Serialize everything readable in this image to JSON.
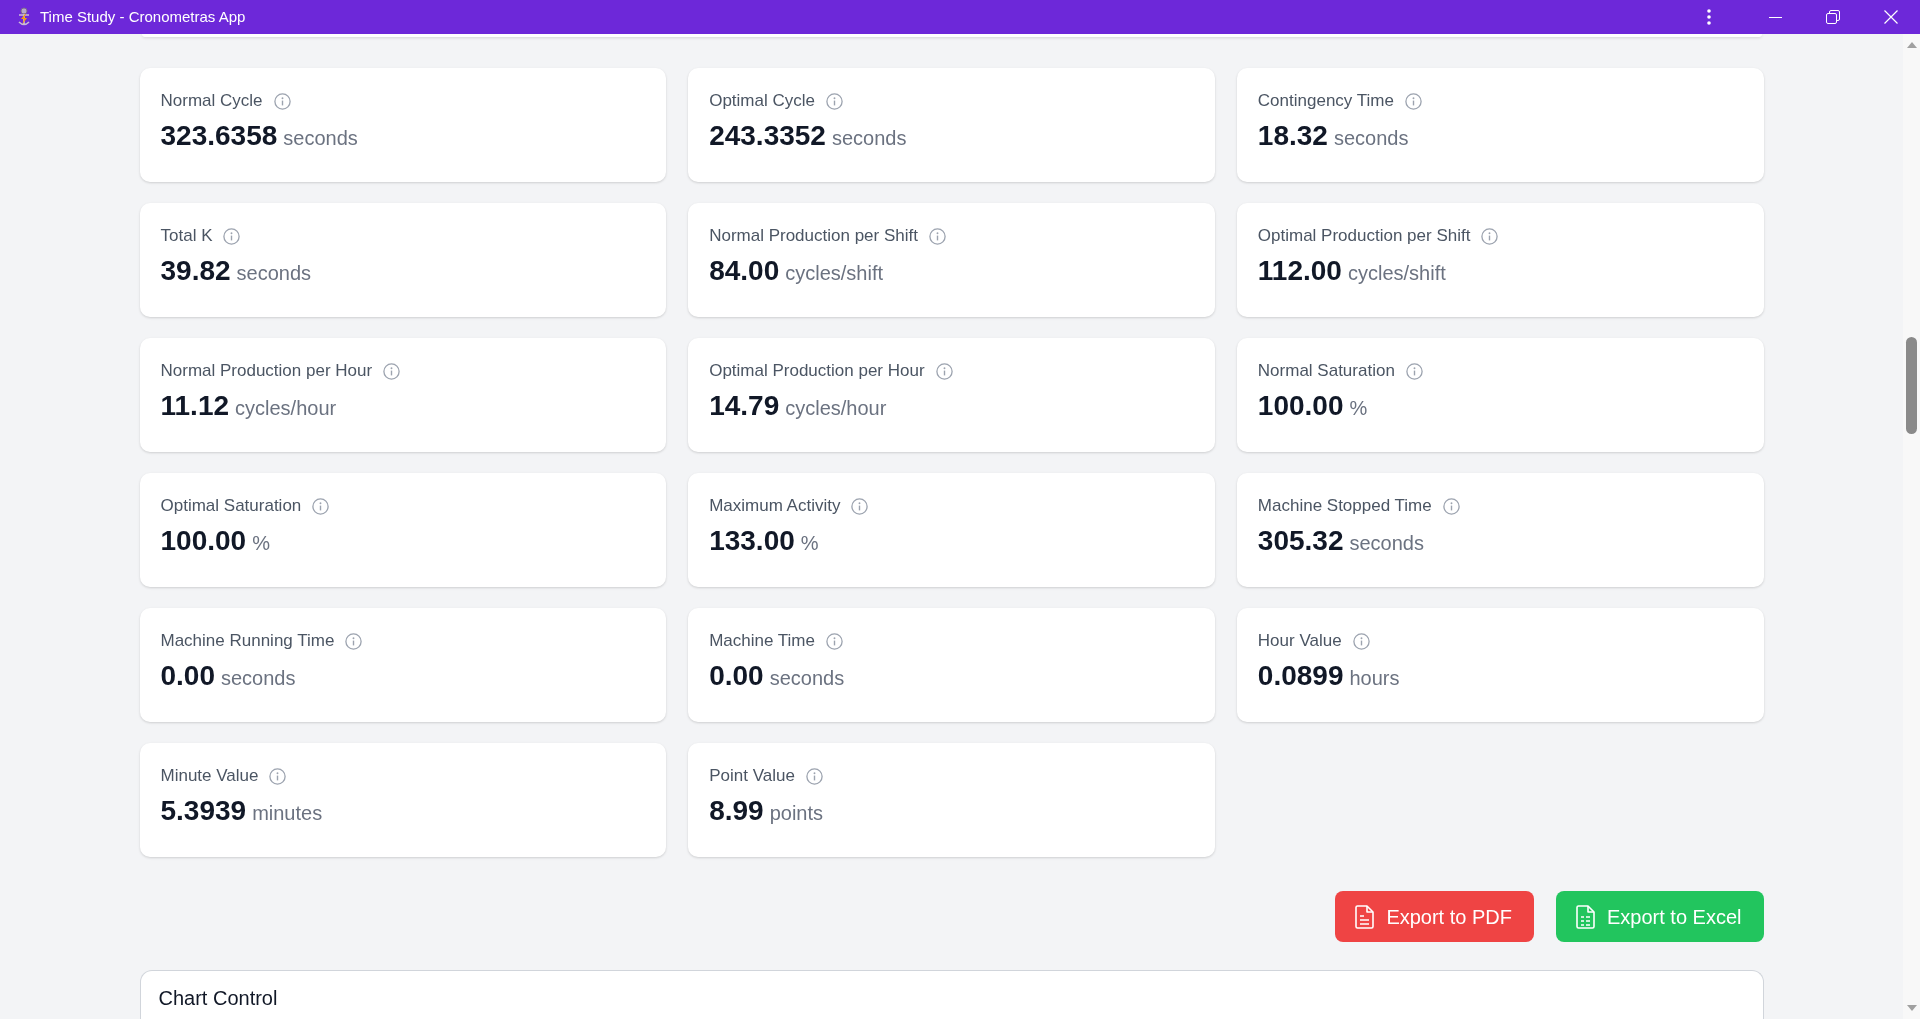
{
  "window": {
    "title": "Time Study - Cronometras App"
  },
  "metrics": [
    {
      "label": "Normal Cycle",
      "value": "323.6358",
      "unit": "seconds"
    },
    {
      "label": "Optimal Cycle",
      "value": "243.3352",
      "unit": "seconds"
    },
    {
      "label": "Contingency Time",
      "value": "18.32",
      "unit": "seconds"
    },
    {
      "label": "Total K",
      "value": "39.82",
      "unit": "seconds"
    },
    {
      "label": "Normal Production per Shift",
      "value": "84.00",
      "unit": "cycles/shift"
    },
    {
      "label": "Optimal Production per Shift",
      "value": "112.00",
      "unit": "cycles/shift"
    },
    {
      "label": "Normal Production per Hour",
      "value": "11.12",
      "unit": "cycles/hour"
    },
    {
      "label": "Optimal Production per Hour",
      "value": "14.79",
      "unit": "cycles/hour"
    },
    {
      "label": "Normal Saturation",
      "value": "100.00",
      "unit": "%"
    },
    {
      "label": "Optimal Saturation",
      "value": "100.00",
      "unit": "%"
    },
    {
      "label": "Maximum Activity",
      "value": "133.00",
      "unit": "%"
    },
    {
      "label": "Machine Stopped Time",
      "value": "305.32",
      "unit": "seconds"
    },
    {
      "label": "Machine Running Time",
      "value": "0.00",
      "unit": "seconds"
    },
    {
      "label": "Machine Time",
      "value": "0.00",
      "unit": "seconds"
    },
    {
      "label": "Hour Value",
      "value": "0.0899",
      "unit": "hours"
    },
    {
      "label": "Minute Value",
      "value": "5.3939",
      "unit": "minutes"
    },
    {
      "label": "Point Value",
      "value": "8.99",
      "unit": "points"
    }
  ],
  "actions": [
    {
      "kind": "pdf",
      "label": "Export to PDF"
    },
    {
      "kind": "excel",
      "label": "Export to Excel"
    }
  ],
  "chart_control": {
    "title": "Chart Control"
  }
}
